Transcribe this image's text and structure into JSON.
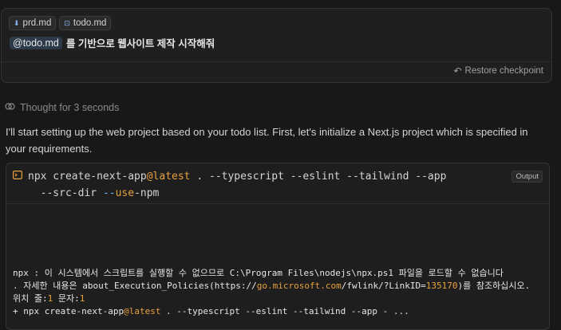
{
  "user_message": {
    "chips": [
      {
        "label": "prd.md",
        "icon": "arrow-down-icon"
      },
      {
        "label": "todo.md",
        "icon": "file-icon"
      }
    ],
    "mention": "@todo.md",
    "prompt": "를 기반으로 웹사이트 제작 시작해줘",
    "restore_label": "Restore checkpoint"
  },
  "thought": {
    "label": "Thought for 3 seconds"
  },
  "assistant": {
    "text": "I'll start setting up the web project based on your todo list. First, let's initialize a Next.js project which is specified in your requirements."
  },
  "terminal": {
    "badge": "Output",
    "command_parts": {
      "p1": "npx create-next-app",
      "p2": "@latest",
      "p3": " . --typescript --eslint --tailwind --app",
      "p4": "--src-dir ",
      "p5": "--",
      "p6": "use",
      "p7": "-npm"
    },
    "output": {
      "line1": "npx : 이 시스템에서 스크립트를 실행할 수 없으므로 C:\\Program Files\\nodejs\\npx.ps1 파일을 로드할 수 없습니다",
      "line2a": ". 자세한 내용은 about_Execution_Policies(https://",
      "line2b": "go.microsoft.com",
      "line2c": "/fwlink/?LinkID=",
      "line2d": "135170",
      "line2e": ")를 참조하십시오.",
      "line3a": "위치 줄:",
      "line3b": "1",
      "line3c": " 문자:",
      "line3d": "1",
      "line4a": "+ npx create-next-app",
      "line4b": "@latest",
      "line4c": " . --typescript --eslint --tailwind --app - ..."
    }
  },
  "colors": {
    "accent_orange": "#e8a13c",
    "accent_blue": "#6fb3ff",
    "background": "#181818"
  }
}
